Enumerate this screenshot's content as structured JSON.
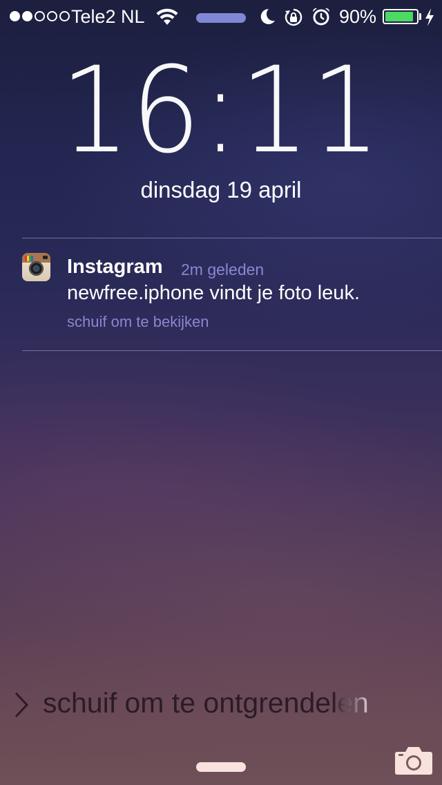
{
  "status_bar": {
    "signal_dots_filled": 2,
    "signal_dots_total": 5,
    "carrier": "Tele2 NL",
    "battery_percent": "90%",
    "battery_level": 0.9,
    "icons": [
      "wifi-icon",
      "activity-pill",
      "moon-icon",
      "rotation-lock-icon",
      "alarm-icon",
      "battery-icon",
      "charging-bolt-icon"
    ]
  },
  "lock_screen": {
    "time_hours": "16",
    "time_minutes": "11",
    "date": "dinsdag 19 april"
  },
  "notification": {
    "app_name": "Instagram",
    "time_ago": "2m geleden",
    "message": "newfree.iphone vindt je foto leuk.",
    "action_hint": "schuif om te bekijken",
    "icon": "instagram-icon"
  },
  "unlock": {
    "label": "schuif om te ontgrendelen",
    "icon": "chevron-right-icon"
  },
  "bottom": {
    "icons": [
      "home-indicator",
      "camera-icon"
    ]
  },
  "colors": {
    "accent_text": "#8a87d0",
    "battery_fill": "#4cd964",
    "activity_pill": "#7f87d6"
  }
}
